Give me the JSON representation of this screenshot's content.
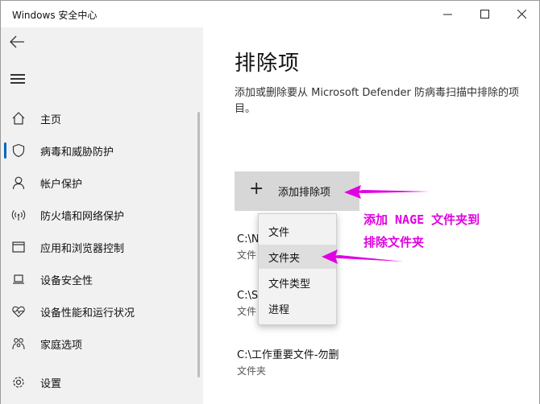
{
  "window": {
    "title": "Windows 安全中心",
    "controls": {
      "minimize": "—",
      "maximize": "☐",
      "close": "✕"
    }
  },
  "sidebar": {
    "back_icon": "←",
    "menu_icon": "hamburger-icon",
    "items": [
      {
        "label": "主页",
        "icon": "home-icon"
      },
      {
        "label": "病毒和威胁防护",
        "icon": "shield-icon",
        "active": true
      },
      {
        "label": "帐户保护",
        "icon": "person-icon"
      },
      {
        "label": "防火墙和网络保护",
        "icon": "wifi-icon"
      },
      {
        "label": "应用和浏览器控制",
        "icon": "app-window-icon"
      },
      {
        "label": "设备安全性",
        "icon": "laptop-icon"
      },
      {
        "label": "设备性能和运行状况",
        "icon": "heart-pulse-icon"
      },
      {
        "label": "家庭选项",
        "icon": "family-icon"
      },
      {
        "label": "设置",
        "icon": "gear-icon"
      }
    ]
  },
  "main": {
    "title": "排除项",
    "description": "添加或删除要从 Microsoft Defender 防病毒扫描中排除的项目。",
    "add_button": {
      "icon": "+",
      "label": "添加排除项"
    },
    "exclusions": [
      {
        "path": "C:\\N",
        "type": "文件"
      },
      {
        "path": "C:\\S",
        "type": "文件"
      },
      {
        "path": "C:\\工作重要文件-勿删",
        "type": "文件夹"
      }
    ],
    "dropdown": {
      "items": [
        "文件",
        "文件夹",
        "文件类型",
        "进程"
      ],
      "hovered": "文件夹"
    }
  },
  "annotation": {
    "line1": "添加 NAGE 文件夹到",
    "line2": "排除文件夹",
    "color": "#e100e1"
  }
}
